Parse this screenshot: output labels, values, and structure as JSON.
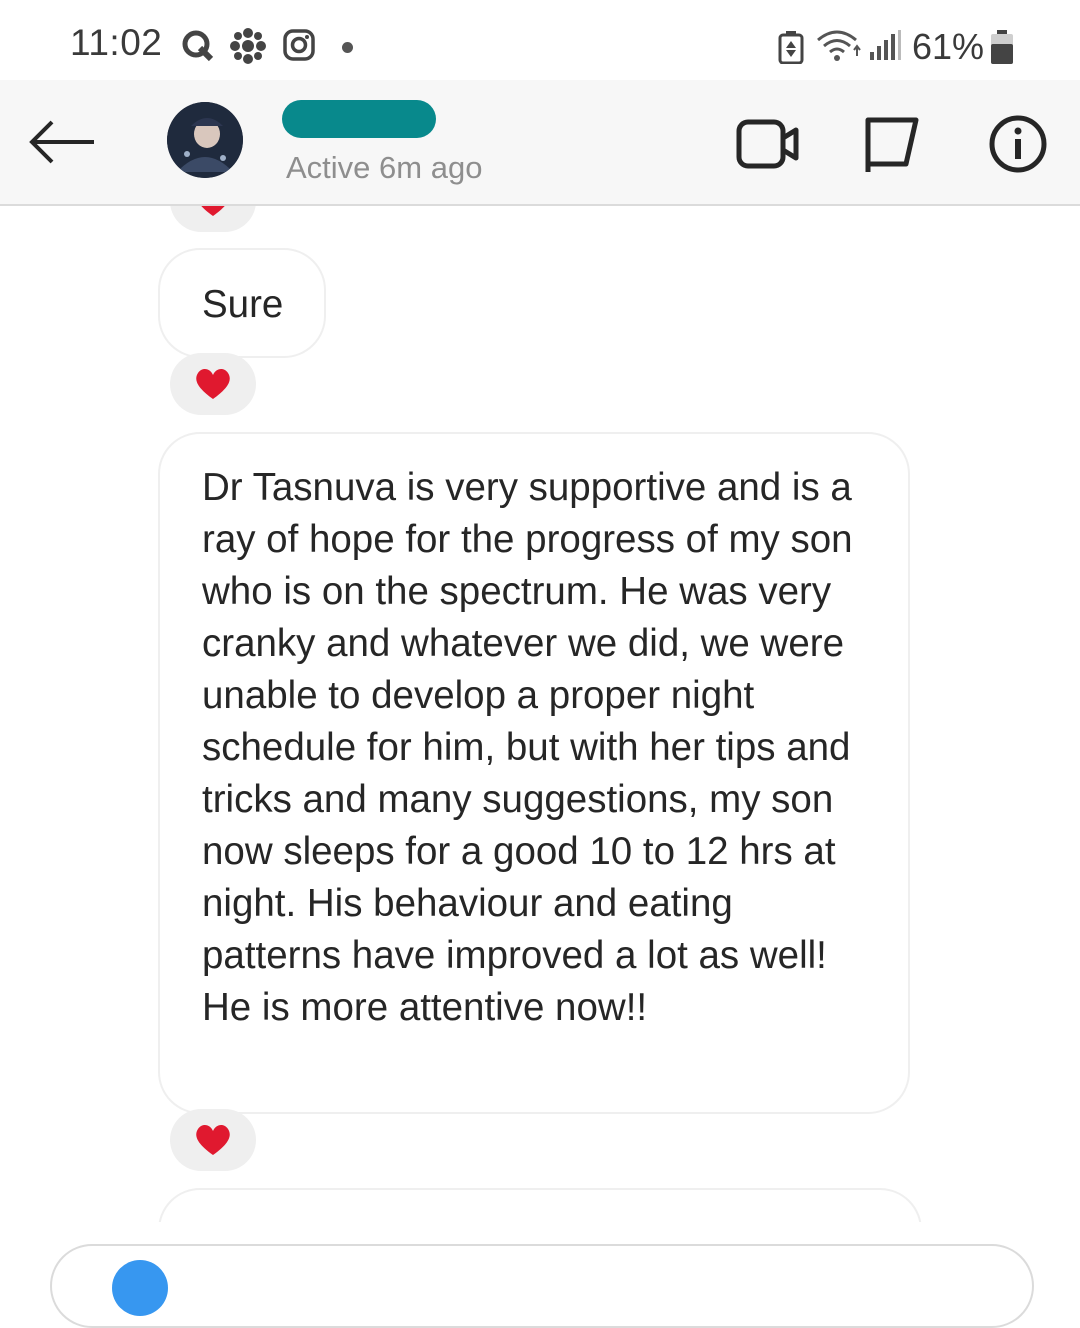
{
  "status_bar": {
    "time": "11:02",
    "battery": "61%",
    "icons": [
      "q-icon",
      "cbc-gem-icon",
      "instagram-icon",
      "battery-saver-icon",
      "wifi-icon",
      "signal-icon",
      "battery-icon"
    ]
  },
  "header": {
    "active_status": "Active 6m ago",
    "icons": [
      "back-arrow-icon",
      "video-call-icon",
      "flag-icon",
      "info-icon"
    ]
  },
  "messages": [
    {
      "text": "Sure",
      "reaction": "heart"
    },
    {
      "text": "Dr Tasnuva is very supportive and is a ray of hope for the progress of my son who is on the spectrum. He was very cranky and whatever we did, we were unable to develop a proper night schedule for him, but with her tips and tricks and many suggestions, my son now sleeps for a good 10 to 12 hrs at night. His behaviour and eating patterns have improved a lot as well! He is more attentive now!!",
      "reaction": "heart"
    }
  ],
  "colors": {
    "header_bg": "#f7f7f7",
    "bubble_border": "#efefef",
    "reaction_bg": "#efefef",
    "heart": "#e0192f",
    "redaction": "#08898c"
  }
}
